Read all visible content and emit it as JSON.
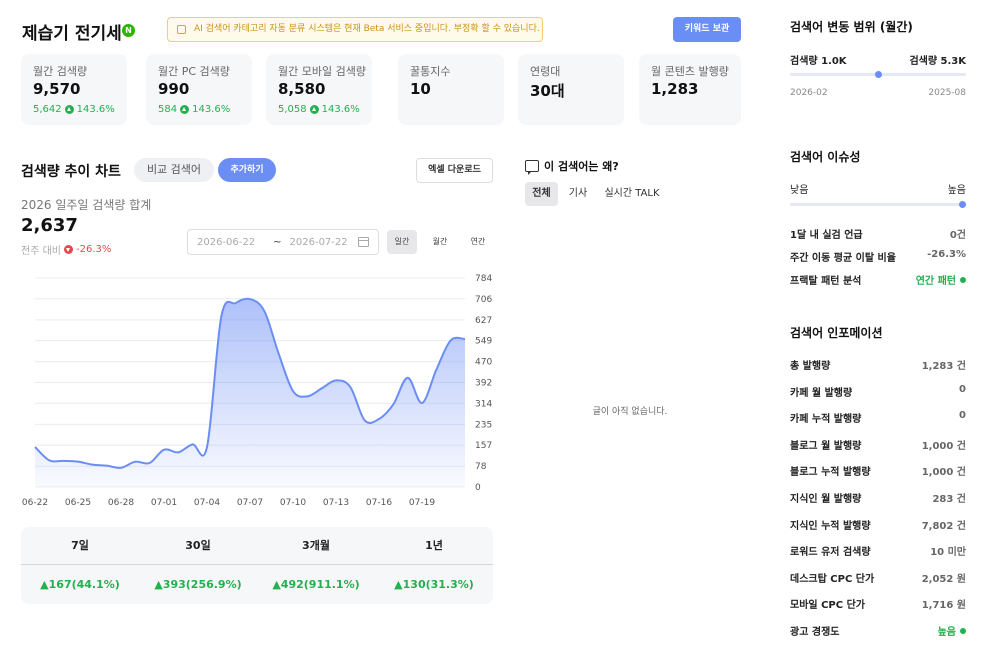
{
  "header": {
    "keyword": "제습기 전기세",
    "badge": "N",
    "notice": "AI 검색어 카테고리 자동 분류 시스템은 현재 Beta 서비스 중입니다. 부정확 할 수 있습니다.",
    "keyword_button": "키워드 보관"
  },
  "stats": [
    {
      "label": "월간 검색량",
      "value": "9,570",
      "sub_value": "5,642",
      "sub_pct": "143.6%"
    },
    {
      "label": "월간 PC 검색량",
      "value": "990",
      "sub_value": "584",
      "sub_pct": "143.6%"
    },
    {
      "label": "월간 모바일 검색량",
      "value": "8,580",
      "sub_value": "5,058",
      "sub_pct": "143.6%"
    },
    {
      "label": "꿀통지수",
      "value": "10"
    },
    {
      "label": "연령대",
      "value": "30대"
    },
    {
      "label": "월 콘텐츠 발행량",
      "value": "1,283"
    }
  ],
  "trend": {
    "title": "검색량 추이 차트",
    "compare_label": "비교 검색어",
    "add_label": "추가하기",
    "excel_label": "엑셀 다운로드",
    "week_label": "2026 일주일 검색량 합계",
    "week_value": "2,637",
    "delta_label": "전주 대비",
    "delta_value": "-26.3%",
    "date_from": "2026-06-22",
    "date_sep": "~",
    "date_to": "2026-07-22",
    "period_tabs": [
      "일간",
      "월간",
      "연간"
    ],
    "active_period": 0
  },
  "chart_data": {
    "type": "area",
    "x": [
      "06-22",
      "06-23",
      "06-24",
      "06-25",
      "06-26",
      "06-27",
      "06-28",
      "06-29",
      "06-30",
      "07-01",
      "07-02",
      "07-03",
      "07-04",
      "07-05",
      "07-06",
      "07-07",
      "07-08",
      "07-09",
      "07-10",
      "07-11",
      "07-12",
      "07-13",
      "07-14",
      "07-15",
      "07-16",
      "07-17",
      "07-18",
      "07-19",
      "07-20",
      "07-21",
      "07-22"
    ],
    "values": [
      150,
      100,
      98,
      95,
      84,
      80,
      72,
      95,
      90,
      140,
      130,
      160,
      150,
      640,
      690,
      705,
      660,
      500,
      360,
      340,
      370,
      400,
      375,
      250,
      255,
      310,
      410,
      315,
      440,
      550,
      555
    ],
    "xticks": [
      "06-22",
      "06-25",
      "06-28",
      "07-01",
      "07-04",
      "07-07",
      "07-10",
      "07-13",
      "07-16",
      "07-19"
    ],
    "yticks": [
      0,
      78,
      157,
      235,
      314,
      392,
      470,
      549,
      627,
      706,
      784
    ],
    "ylim": [
      0,
      784
    ],
    "grid": true,
    "color": "#6b8ef5"
  },
  "summary": {
    "columns": [
      "7일",
      "30일",
      "3개월",
      "1년"
    ],
    "values": [
      "▲167(44.1%)",
      "▲393(256.9%)",
      "▲492(911.1%)",
      "▲130(31.3%)"
    ]
  },
  "why": {
    "title": "이 검색어는 왜?",
    "tabs": [
      "전체",
      "기사",
      "실시간 TALK"
    ],
    "empty": "글이 아직 없습니다."
  },
  "range": {
    "title": "검색어 변동 범위 (월간)",
    "min_label": "검색량 1.0K",
    "max_label": "검색량 5.3K",
    "start_date": "2026-02",
    "end_date": "2025-08",
    "position": 0.5
  },
  "issue": {
    "title": "검색어 이슈성",
    "low": "낮음",
    "high": "높음",
    "level": 1.0,
    "rows": [
      {
        "label": "1달 내 실검 언급",
        "value": "0건"
      },
      {
        "label": "주간 이동 평균 이탈 비율",
        "value": "-26.3%"
      },
      {
        "label": "프랙탈 패턴 분석",
        "value": "연간 패턴"
      }
    ]
  },
  "info": {
    "title": "검색어 인포메이션",
    "rows": [
      {
        "label": "총 발행량",
        "value": "1,283 건"
      },
      {
        "label": "카페 월 발행량",
        "value": "0"
      },
      {
        "label": "카페 누적 발행량",
        "value": "0"
      },
      {
        "label": "블로그 월 발행량",
        "value": "1,000 건"
      },
      {
        "label": "블로그 누적 발행량",
        "value": "1,000 건"
      },
      {
        "label": "지식인 월 발행량",
        "value": "283 건"
      },
      {
        "label": "지식인 누적 발행량",
        "value": "7,802 건"
      },
      {
        "label": "로워드 유저 검색량",
        "value": "10 미만"
      },
      {
        "label": "데스크탑 CPC 단가",
        "value": "2,052 원"
      },
      {
        "label": "모바일 CPC 단가",
        "value": "1,716 원"
      },
      {
        "label": "광고 경쟁도",
        "value": "높음"
      }
    ]
  }
}
